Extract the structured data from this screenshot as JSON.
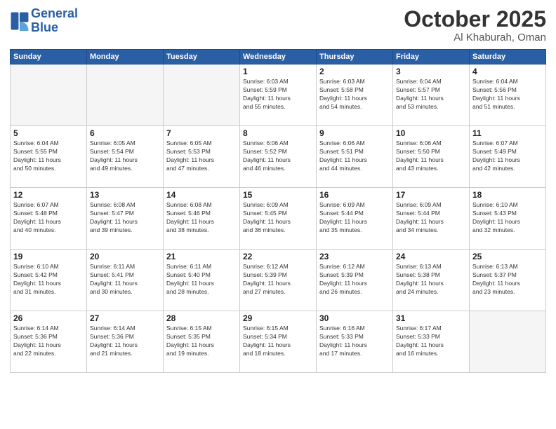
{
  "header": {
    "logo_line1": "General",
    "logo_line2": "Blue",
    "month": "October 2025",
    "location": "Al Khaburah, Oman"
  },
  "weekdays": [
    "Sunday",
    "Monday",
    "Tuesday",
    "Wednesday",
    "Thursday",
    "Friday",
    "Saturday"
  ],
  "weeks": [
    [
      {
        "day": "",
        "info": ""
      },
      {
        "day": "",
        "info": ""
      },
      {
        "day": "",
        "info": ""
      },
      {
        "day": "1",
        "info": "Sunrise: 6:03 AM\nSunset: 5:59 PM\nDaylight: 11 hours\nand 55 minutes."
      },
      {
        "day": "2",
        "info": "Sunrise: 6:03 AM\nSunset: 5:58 PM\nDaylight: 11 hours\nand 54 minutes."
      },
      {
        "day": "3",
        "info": "Sunrise: 6:04 AM\nSunset: 5:57 PM\nDaylight: 11 hours\nand 53 minutes."
      },
      {
        "day": "4",
        "info": "Sunrise: 6:04 AM\nSunset: 5:56 PM\nDaylight: 11 hours\nand 51 minutes."
      }
    ],
    [
      {
        "day": "5",
        "info": "Sunrise: 6:04 AM\nSunset: 5:55 PM\nDaylight: 11 hours\nand 50 minutes."
      },
      {
        "day": "6",
        "info": "Sunrise: 6:05 AM\nSunset: 5:54 PM\nDaylight: 11 hours\nand 49 minutes."
      },
      {
        "day": "7",
        "info": "Sunrise: 6:05 AM\nSunset: 5:53 PM\nDaylight: 11 hours\nand 47 minutes."
      },
      {
        "day": "8",
        "info": "Sunrise: 6:06 AM\nSunset: 5:52 PM\nDaylight: 11 hours\nand 46 minutes."
      },
      {
        "day": "9",
        "info": "Sunrise: 6:06 AM\nSunset: 5:51 PM\nDaylight: 11 hours\nand 44 minutes."
      },
      {
        "day": "10",
        "info": "Sunrise: 6:06 AM\nSunset: 5:50 PM\nDaylight: 11 hours\nand 43 minutes."
      },
      {
        "day": "11",
        "info": "Sunrise: 6:07 AM\nSunset: 5:49 PM\nDaylight: 11 hours\nand 42 minutes."
      }
    ],
    [
      {
        "day": "12",
        "info": "Sunrise: 6:07 AM\nSunset: 5:48 PM\nDaylight: 11 hours\nand 40 minutes."
      },
      {
        "day": "13",
        "info": "Sunrise: 6:08 AM\nSunset: 5:47 PM\nDaylight: 11 hours\nand 39 minutes."
      },
      {
        "day": "14",
        "info": "Sunrise: 6:08 AM\nSunset: 5:46 PM\nDaylight: 11 hours\nand 38 minutes."
      },
      {
        "day": "15",
        "info": "Sunrise: 6:09 AM\nSunset: 5:45 PM\nDaylight: 11 hours\nand 36 minutes."
      },
      {
        "day": "16",
        "info": "Sunrise: 6:09 AM\nSunset: 5:44 PM\nDaylight: 11 hours\nand 35 minutes."
      },
      {
        "day": "17",
        "info": "Sunrise: 6:09 AM\nSunset: 5:44 PM\nDaylight: 11 hours\nand 34 minutes."
      },
      {
        "day": "18",
        "info": "Sunrise: 6:10 AM\nSunset: 5:43 PM\nDaylight: 11 hours\nand 32 minutes."
      }
    ],
    [
      {
        "day": "19",
        "info": "Sunrise: 6:10 AM\nSunset: 5:42 PM\nDaylight: 11 hours\nand 31 minutes."
      },
      {
        "day": "20",
        "info": "Sunrise: 6:11 AM\nSunset: 5:41 PM\nDaylight: 11 hours\nand 30 minutes."
      },
      {
        "day": "21",
        "info": "Sunrise: 6:11 AM\nSunset: 5:40 PM\nDaylight: 11 hours\nand 28 minutes."
      },
      {
        "day": "22",
        "info": "Sunrise: 6:12 AM\nSunset: 5:39 PM\nDaylight: 11 hours\nand 27 minutes."
      },
      {
        "day": "23",
        "info": "Sunrise: 6:12 AM\nSunset: 5:39 PM\nDaylight: 11 hours\nand 26 minutes."
      },
      {
        "day": "24",
        "info": "Sunrise: 6:13 AM\nSunset: 5:38 PM\nDaylight: 11 hours\nand 24 minutes."
      },
      {
        "day": "25",
        "info": "Sunrise: 6:13 AM\nSunset: 5:37 PM\nDaylight: 11 hours\nand 23 minutes."
      }
    ],
    [
      {
        "day": "26",
        "info": "Sunrise: 6:14 AM\nSunset: 5:36 PM\nDaylight: 11 hours\nand 22 minutes."
      },
      {
        "day": "27",
        "info": "Sunrise: 6:14 AM\nSunset: 5:36 PM\nDaylight: 11 hours\nand 21 minutes."
      },
      {
        "day": "28",
        "info": "Sunrise: 6:15 AM\nSunset: 5:35 PM\nDaylight: 11 hours\nand 19 minutes."
      },
      {
        "day": "29",
        "info": "Sunrise: 6:15 AM\nSunset: 5:34 PM\nDaylight: 11 hours\nand 18 minutes."
      },
      {
        "day": "30",
        "info": "Sunrise: 6:16 AM\nSunset: 5:33 PM\nDaylight: 11 hours\nand 17 minutes."
      },
      {
        "day": "31",
        "info": "Sunrise: 6:17 AM\nSunset: 5:33 PM\nDaylight: 11 hours\nand 16 minutes."
      },
      {
        "day": "",
        "info": ""
      }
    ]
  ]
}
